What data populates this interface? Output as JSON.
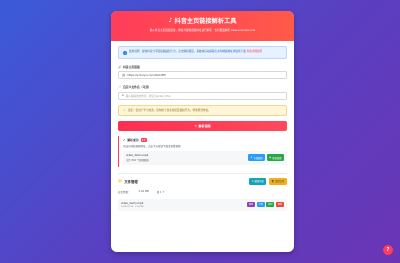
{
  "header": {
    "title": "抖音主页链接解析工具",
    "subtitle": "输入抖音主页视频链接，解析并提取视频地址进行解析 · 支持批量解析 www.example.com"
  },
  "info": {
    "text": "使用说明：复制抖音分享链接粘贴到下方，点击解析按钮，系统将自动获取无水印视频地址并提供下载",
    "link": "查看详细说明"
  },
  "url_field": {
    "label": "抖音主页链接",
    "value": "https://v.douyin.com/iAbCdEf/"
  },
  "name_field": {
    "label": "自定义文件名（可选）",
    "placeholder": "输入保存的文件名，默认为video_title"
  },
  "warning": {
    "text": "注意：仅用于学习交流，请勿用于商业用途及侵权行为，尊重原创作者。"
  },
  "parse_button": "解析视频",
  "result": {
    "title": "解析成功",
    "badge": "1个",
    "desc": "已成功获取视频地址，点击下方按钮下载或查看视频",
    "video_name": "video_demo.mp4",
    "video_size": "文件 892 个视频数据",
    "download_label": "下载视频",
    "preview_label": "预览视频"
  },
  "file_manager": {
    "title": "文件管理",
    "refresh_label": "刷新列表",
    "clear_label": "清空文件",
    "stats_label": "总文件数：",
    "stats_size": "2.04 MB",
    "stats_count": "共 1 个",
    "file_name": "video_demo.mp4",
    "file_meta": "2024-05-18 · 2.04 MB",
    "actions": [
      "播放",
      "下载",
      "复制",
      "删除"
    ]
  },
  "help_button": "?",
  "colors": {
    "accent": "#ff3d5a",
    "background_start": "#3a5bd9",
    "background_end": "#6a35b5"
  }
}
